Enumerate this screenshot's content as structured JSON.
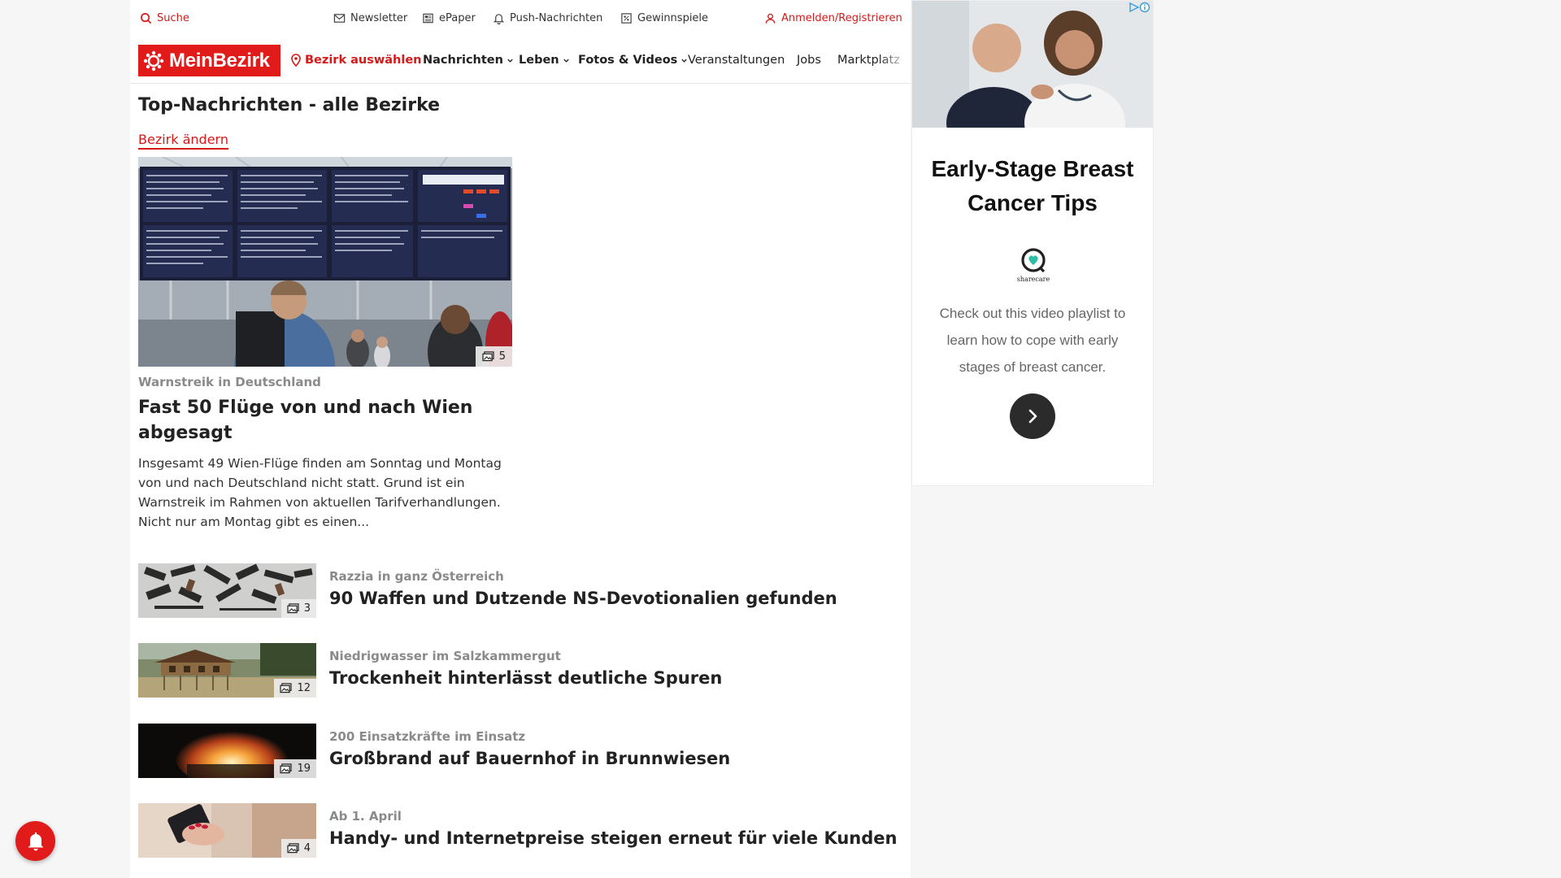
{
  "utility": {
    "search": "Suche",
    "newsletter": "Newsletter",
    "epaper": "ePaper",
    "push": "Push-Nachrichten",
    "contests": "Gewinnspiele",
    "login": "Anmelden/Registrieren"
  },
  "nav": {
    "logo": "MeinBezirk",
    "district": "Bezirk auswählen",
    "items": [
      "Nachrichten",
      "Leben",
      "Fotos & Videos",
      "Veranstaltungen",
      "Jobs",
      "Marktplatz"
    ]
  },
  "main": {
    "section_title": "Top-Nachrichten - alle Bezirke",
    "change_link": "Bezirk ändern",
    "hero": {
      "photo_count": "5",
      "kicker": "Warnstreik in Deutschland",
      "title": "Fast 50 Flüge von und nach Wien abgesagt",
      "teaser": "Insgesamt 49 Wien-Flüge finden am Sonntag und Montag von und nach Deutschland nicht statt. Grund ist ein Warnstreik im Rahmen von aktuellen Tarifverhandlungen. Nicht nur am Montag gibt es einen..."
    },
    "articles": [
      {
        "photo_count": "3",
        "kicker": "Razzia in ganz Österreich",
        "title": "90 Waffen und Dutzende NS-Devotionalien gefunden"
      },
      {
        "photo_count": "12",
        "kicker": "Niedrigwasser im Salzkammergut",
        "title": "Trockenheit hinterlässt deutliche Spuren"
      },
      {
        "photo_count": "19",
        "kicker": "200 Einsatzkräfte im Einsatz",
        "title": "Großbrand auf Bauernhof in Brunnwiesen"
      },
      {
        "photo_count": "4",
        "kicker": "Ab 1. April",
        "title": "Handy- und Internetpreise steigen erneut für viele Kunden"
      }
    ]
  },
  "ad": {
    "title": "Early-Stage Breast Cancer Tips",
    "brand": "sharecare",
    "text": "Check out this video playlist to learn how to cope with early stages of breast cancer."
  },
  "colors": {
    "brand_red": "#e11a1a",
    "link_red": "#d51a1a",
    "kicker_gray": "#8a8a8a"
  },
  "icons": {
    "search": "search-icon",
    "newsletter": "mail-icon",
    "epaper": "newspaper-icon",
    "push": "bell-icon",
    "contests": "gift-icon",
    "login": "user-icon",
    "district": "location-pin-icon",
    "gallery": "gallery-icon",
    "ad_next": "chevron-right-icon",
    "notification": "bell-icon"
  }
}
